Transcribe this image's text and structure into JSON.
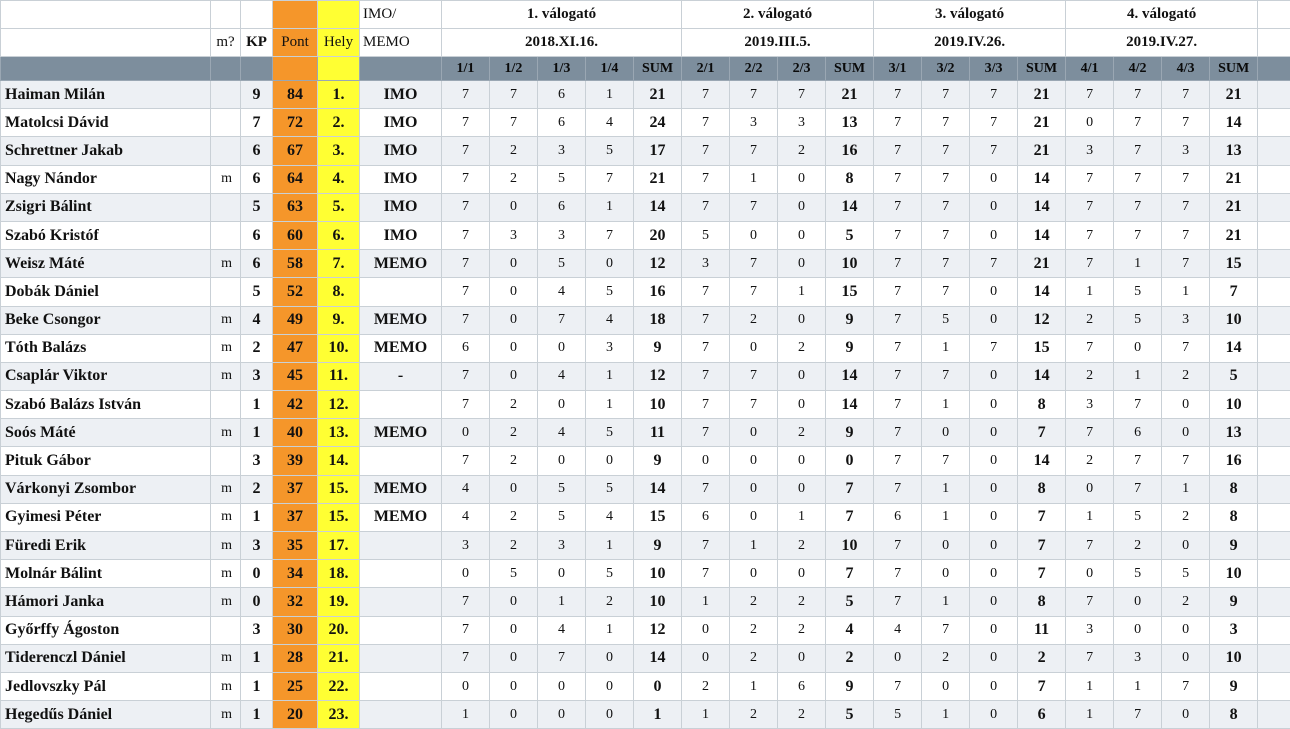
{
  "headers": {
    "m_label": "m?",
    "kp_label": "KP",
    "pont_label": "Pont",
    "hely_label": "Hely",
    "imo_label_1": "IMO/",
    "imo_label_2": "MEMO",
    "rounds": [
      {
        "title": "1. válogató",
        "date": "2018.XI.16.",
        "problems": [
          "1/1",
          "1/2",
          "1/3",
          "1/4"
        ]
      },
      {
        "title": "2. válogató",
        "date": "2019.III.5.",
        "problems": [
          "2/1",
          "2/2",
          "2/3"
        ]
      },
      {
        "title": "3. válogató",
        "date": "2019.IV.26.",
        "problems": [
          "3/1",
          "3/2",
          "3/3"
        ]
      },
      {
        "title": "4. válogató",
        "date": "2019.IV.27.",
        "problems": [
          "4/1",
          "4/2",
          "4/3"
        ]
      }
    ],
    "sum_label": "SUM"
  },
  "rows": [
    {
      "name": "Haiman Milán",
      "m": "",
      "kp": "9",
      "pont": "84",
      "hely": "1.",
      "imo": "IMO",
      "r1": [
        "7",
        "7",
        "6",
        "1"
      ],
      "s1": "21",
      "r2": [
        "7",
        "7",
        "7"
      ],
      "s2": "21",
      "r3": [
        "7",
        "7",
        "7"
      ],
      "s3": "21",
      "r4": [
        "7",
        "7",
        "7"
      ],
      "s4": "21"
    },
    {
      "name": "Matolcsi Dávid",
      "m": "",
      "kp": "7",
      "pont": "72",
      "hely": "2.",
      "imo": "IMO",
      "r1": [
        "7",
        "7",
        "6",
        "4"
      ],
      "s1": "24",
      "r2": [
        "7",
        "3",
        "3"
      ],
      "s2": "13",
      "r3": [
        "7",
        "7",
        "7"
      ],
      "s3": "21",
      "r4": [
        "0",
        "7",
        "7"
      ],
      "s4": "14"
    },
    {
      "name": "Schrettner Jakab",
      "m": "",
      "kp": "6",
      "pont": "67",
      "hely": "3.",
      "imo": "IMO",
      "r1": [
        "7",
        "2",
        "3",
        "5"
      ],
      "s1": "17",
      "r2": [
        "7",
        "7",
        "2"
      ],
      "s2": "16",
      "r3": [
        "7",
        "7",
        "7"
      ],
      "s3": "21",
      "r4": [
        "3",
        "7",
        "3"
      ],
      "s4": "13"
    },
    {
      "name": "Nagy Nándor",
      "m": "m",
      "kp": "6",
      "pont": "64",
      "hely": "4.",
      "imo": "IMO",
      "r1": [
        "7",
        "2",
        "5",
        "7"
      ],
      "s1": "21",
      "r2": [
        "7",
        "1",
        "0"
      ],
      "s2": "8",
      "r3": [
        "7",
        "7",
        "0"
      ],
      "s3": "14",
      "r4": [
        "7",
        "7",
        "7"
      ],
      "s4": "21"
    },
    {
      "name": "Zsigri Bálint",
      "m": "",
      "kp": "5",
      "pont": "63",
      "hely": "5.",
      "imo": "IMO",
      "r1": [
        "7",
        "0",
        "6",
        "1"
      ],
      "s1": "14",
      "r2": [
        "7",
        "7",
        "0"
      ],
      "s2": "14",
      "r3": [
        "7",
        "7",
        "0"
      ],
      "s3": "14",
      "r4": [
        "7",
        "7",
        "7"
      ],
      "s4": "21"
    },
    {
      "name": "Szabó Kristóf",
      "m": "",
      "kp": "6",
      "pont": "60",
      "hely": "6.",
      "imo": "IMO",
      "r1": [
        "7",
        "3",
        "3",
        "7"
      ],
      "s1": "20",
      "r2": [
        "5",
        "0",
        "0"
      ],
      "s2": "5",
      "r3": [
        "7",
        "7",
        "0"
      ],
      "s3": "14",
      "r4": [
        "7",
        "7",
        "7"
      ],
      "s4": "21"
    },
    {
      "name": "Weisz Máté",
      "m": "m",
      "kp": "6",
      "pont": "58",
      "hely": "7.",
      "imo": "MEMO",
      "r1": [
        "7",
        "0",
        "5",
        "0"
      ],
      "s1": "12",
      "r2": [
        "3",
        "7",
        "0"
      ],
      "s2": "10",
      "r3": [
        "7",
        "7",
        "7"
      ],
      "s3": "21",
      "r4": [
        "7",
        "1",
        "7"
      ],
      "s4": "15"
    },
    {
      "name": "Dobák Dániel",
      "m": "",
      "kp": "5",
      "pont": "52",
      "hely": "8.",
      "imo": "",
      "r1": [
        "7",
        "0",
        "4",
        "5"
      ],
      "s1": "16",
      "r2": [
        "7",
        "7",
        "1"
      ],
      "s2": "15",
      "r3": [
        "7",
        "7",
        "0"
      ],
      "s3": "14",
      "r4": [
        "1",
        "5",
        "1"
      ],
      "s4": "7"
    },
    {
      "name": "Beke Csongor",
      "m": "m",
      "kp": "4",
      "pont": "49",
      "hely": "9.",
      "imo": "MEMO",
      "r1": [
        "7",
        "0",
        "7",
        "4"
      ],
      "s1": "18",
      "r2": [
        "7",
        "2",
        "0"
      ],
      "s2": "9",
      "r3": [
        "7",
        "5",
        "0"
      ],
      "s3": "12",
      "r4": [
        "2",
        "5",
        "3"
      ],
      "s4": "10"
    },
    {
      "name": "Tóth Balázs",
      "m": "m",
      "kp": "2",
      "pont": "47",
      "hely": "10.",
      "imo": "MEMO",
      "r1": [
        "6",
        "0",
        "0",
        "3"
      ],
      "s1": "9",
      "r2": [
        "7",
        "0",
        "2"
      ],
      "s2": "9",
      "r3": [
        "7",
        "1",
        "7"
      ],
      "s3": "15",
      "r4": [
        "7",
        "0",
        "7"
      ],
      "s4": "14"
    },
    {
      "name": "Csaplár Viktor",
      "m": "m",
      "kp": "3",
      "pont": "45",
      "hely": "11.",
      "imo": "-",
      "r1": [
        "7",
        "0",
        "4",
        "1"
      ],
      "s1": "12",
      "r2": [
        "7",
        "7",
        "0"
      ],
      "s2": "14",
      "r3": [
        "7",
        "7",
        "0"
      ],
      "s3": "14",
      "r4": [
        "2",
        "1",
        "2"
      ],
      "s4": "5"
    },
    {
      "name": "Szabó Balázs István",
      "m": "",
      "kp": "1",
      "pont": "42",
      "hely": "12.",
      "imo": "",
      "r1": [
        "7",
        "2",
        "0",
        "1"
      ],
      "s1": "10",
      "r2": [
        "7",
        "7",
        "0"
      ],
      "s2": "14",
      "r3": [
        "7",
        "1",
        "0"
      ],
      "s3": "8",
      "r4": [
        "3",
        "7",
        "0"
      ],
      "s4": "10"
    },
    {
      "name": "Soós Máté",
      "m": "m",
      "kp": "1",
      "pont": "40",
      "hely": "13.",
      "imo": "MEMO",
      "r1": [
        "0",
        "2",
        "4",
        "5"
      ],
      "s1": "11",
      "r2": [
        "7",
        "0",
        "2"
      ],
      "s2": "9",
      "r3": [
        "7",
        "0",
        "0"
      ],
      "s3": "7",
      "r4": [
        "7",
        "6",
        "0"
      ],
      "s4": "13"
    },
    {
      "name": "Pituk Gábor",
      "m": "",
      "kp": "3",
      "pont": "39",
      "hely": "14.",
      "imo": "",
      "r1": [
        "7",
        "2",
        "0",
        "0"
      ],
      "s1": "9",
      "r2": [
        "0",
        "0",
        "0"
      ],
      "s2": "0",
      "r3": [
        "7",
        "7",
        "0"
      ],
      "s3": "14",
      "r4": [
        "2",
        "7",
        "7"
      ],
      "s4": "16"
    },
    {
      "name": "Várkonyi Zsombor",
      "m": "m",
      "kp": "2",
      "pont": "37",
      "hely": "15.",
      "imo": "MEMO",
      "r1": [
        "4",
        "0",
        "5",
        "5"
      ],
      "s1": "14",
      "r2": [
        "7",
        "0",
        "0"
      ],
      "s2": "7",
      "r3": [
        "7",
        "1",
        "0"
      ],
      "s3": "8",
      "r4": [
        "0",
        "7",
        "1"
      ],
      "s4": "8"
    },
    {
      "name": "Gyimesi Péter",
      "m": "m",
      "kp": "1",
      "pont": "37",
      "hely": "15.",
      "imo": "MEMO",
      "r1": [
        "4",
        "2",
        "5",
        "4"
      ],
      "s1": "15",
      "r2": [
        "6",
        "0",
        "1"
      ],
      "s2": "7",
      "r3": [
        "6",
        "1",
        "0"
      ],
      "s3": "7",
      "r4": [
        "1",
        "5",
        "2"
      ],
      "s4": "8"
    },
    {
      "name": "Füredi Erik",
      "m": "m",
      "kp": "3",
      "pont": "35",
      "hely": "17.",
      "imo": "",
      "r1": [
        "3",
        "2",
        "3",
        "1"
      ],
      "s1": "9",
      "r2": [
        "7",
        "1",
        "2"
      ],
      "s2": "10",
      "r3": [
        "7",
        "0",
        "0"
      ],
      "s3": "7",
      "r4": [
        "7",
        "2",
        "0"
      ],
      "s4": "9"
    },
    {
      "name": "Molnár Bálint",
      "m": "m",
      "kp": "0",
      "pont": "34",
      "hely": "18.",
      "imo": "",
      "r1": [
        "0",
        "5",
        "0",
        "5"
      ],
      "s1": "10",
      "r2": [
        "7",
        "0",
        "0"
      ],
      "s2": "7",
      "r3": [
        "7",
        "0",
        "0"
      ],
      "s3": "7",
      "r4": [
        "0",
        "5",
        "5"
      ],
      "s4": "10"
    },
    {
      "name": "Hámori Janka",
      "m": "m",
      "kp": "0",
      "pont": "32",
      "hely": "19.",
      "imo": "",
      "r1": [
        "7",
        "0",
        "1",
        "2"
      ],
      "s1": "10",
      "r2": [
        "1",
        "2",
        "2"
      ],
      "s2": "5",
      "r3": [
        "7",
        "1",
        "0"
      ],
      "s3": "8",
      "r4": [
        "7",
        "0",
        "2"
      ],
      "s4": "9"
    },
    {
      "name": "Győrffy Ágoston",
      "m": "",
      "kp": "3",
      "pont": "30",
      "hely": "20.",
      "imo": "",
      "r1": [
        "7",
        "0",
        "4",
        "1"
      ],
      "s1": "12",
      "r2": [
        "0",
        "2",
        "2"
      ],
      "s2": "4",
      "r3": [
        "4",
        "7",
        "0"
      ],
      "s3": "11",
      "r4": [
        "3",
        "0",
        "0"
      ],
      "s4": "3"
    },
    {
      "name": "Tiderenczl Dániel",
      "m": "m",
      "kp": "1",
      "pont": "28",
      "hely": "21.",
      "imo": "",
      "r1": [
        "7",
        "0",
        "7",
        "0"
      ],
      "s1": "14",
      "r2": [
        "0",
        "2",
        "0"
      ],
      "s2": "2",
      "r3": [
        "0",
        "2",
        "0"
      ],
      "s3": "2",
      "r4": [
        "7",
        "3",
        "0"
      ],
      "s4": "10"
    },
    {
      "name": "Jedlovszky Pál",
      "m": "m",
      "kp": "1",
      "pont": "25",
      "hely": "22.",
      "imo": "",
      "r1": [
        "0",
        "0",
        "0",
        "0"
      ],
      "s1": "0",
      "r2": [
        "2",
        "1",
        "6"
      ],
      "s2": "9",
      "r3": [
        "7",
        "0",
        "0"
      ],
      "s3": "7",
      "r4": [
        "1",
        "1",
        "7"
      ],
      "s4": "9"
    },
    {
      "name": "Hegedűs Dániel",
      "m": "m",
      "kp": "1",
      "pont": "20",
      "hely": "23.",
      "imo": "",
      "r1": [
        "1",
        "0",
        "0",
        "0"
      ],
      "s1": "1",
      "r2": [
        "1",
        "2",
        "2"
      ],
      "s2": "5",
      "r3": [
        "5",
        "1",
        "0"
      ],
      "s3": "6",
      "r4": [
        "1",
        "7",
        "0"
      ],
      "s4": "8"
    }
  ],
  "colors": {
    "pont_bg": "#f5962a",
    "hely_bg": "#ffff33",
    "header_bar": "#7d8e9d",
    "row_stripe": "#edf0f4"
  }
}
